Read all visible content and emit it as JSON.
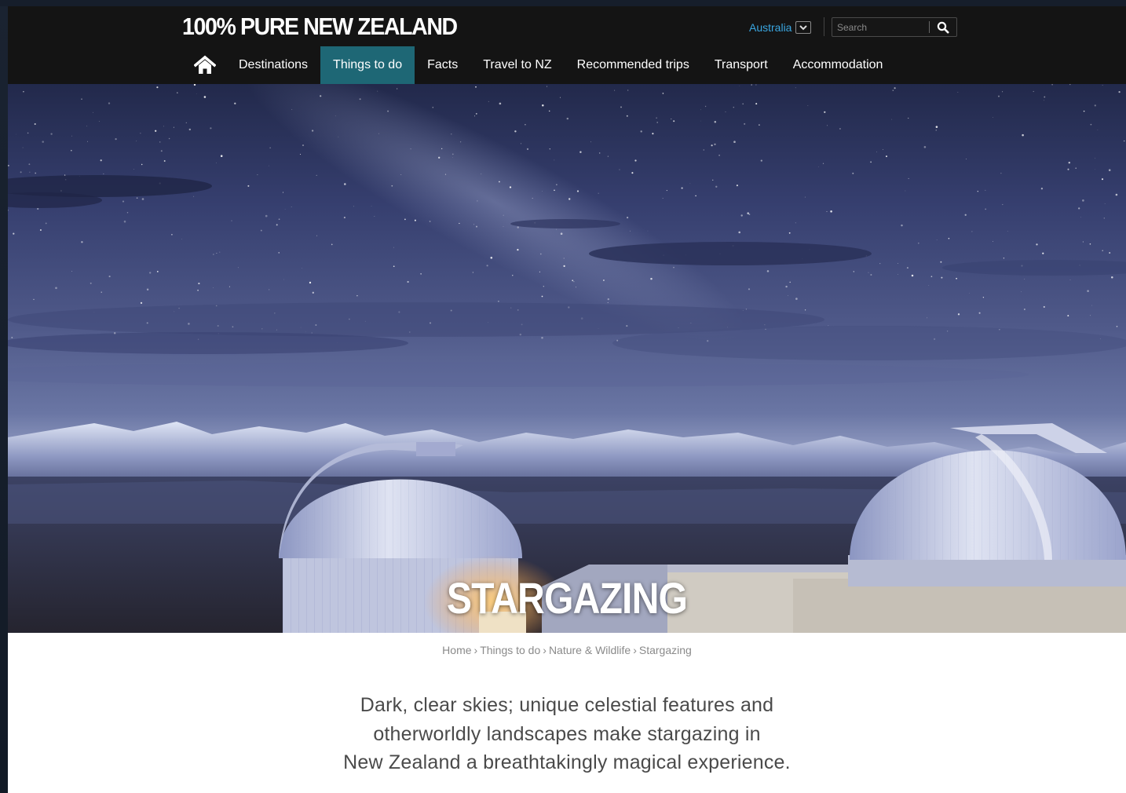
{
  "header": {
    "logo": "100% PURE NEW ZEALAND",
    "country": "Australia",
    "search": {
      "placeholder": "Search"
    }
  },
  "nav": {
    "home_icon": "home-icon",
    "items": [
      {
        "label": "Destinations",
        "active": false
      },
      {
        "label": "Things to do",
        "active": true
      },
      {
        "label": "Facts",
        "active": false
      },
      {
        "label": "Travel to NZ",
        "active": false
      },
      {
        "label": "Recommended trips",
        "active": false
      },
      {
        "label": "Transport",
        "active": false
      },
      {
        "label": "Accommodation",
        "active": false
      }
    ]
  },
  "hero": {
    "title": "STARGAZING"
  },
  "breadcrumb": {
    "items": [
      "Home",
      "Things to do",
      "Nature & Wildlife"
    ],
    "separator": "›",
    "current": "Stargazing"
  },
  "intro": {
    "lines": [
      "Dark, clear skies; unique celestial features and",
      "otherworldly landscapes make stargazing in",
      "New Zealand a breathtakingly magical experience."
    ]
  },
  "colors": {
    "header_bg": "#141414",
    "active_nav": "#1e6775",
    "country_link": "#3aa6e0",
    "body_text": "#4a4a4a",
    "breadcrumb_text": "#8a8a8a"
  }
}
